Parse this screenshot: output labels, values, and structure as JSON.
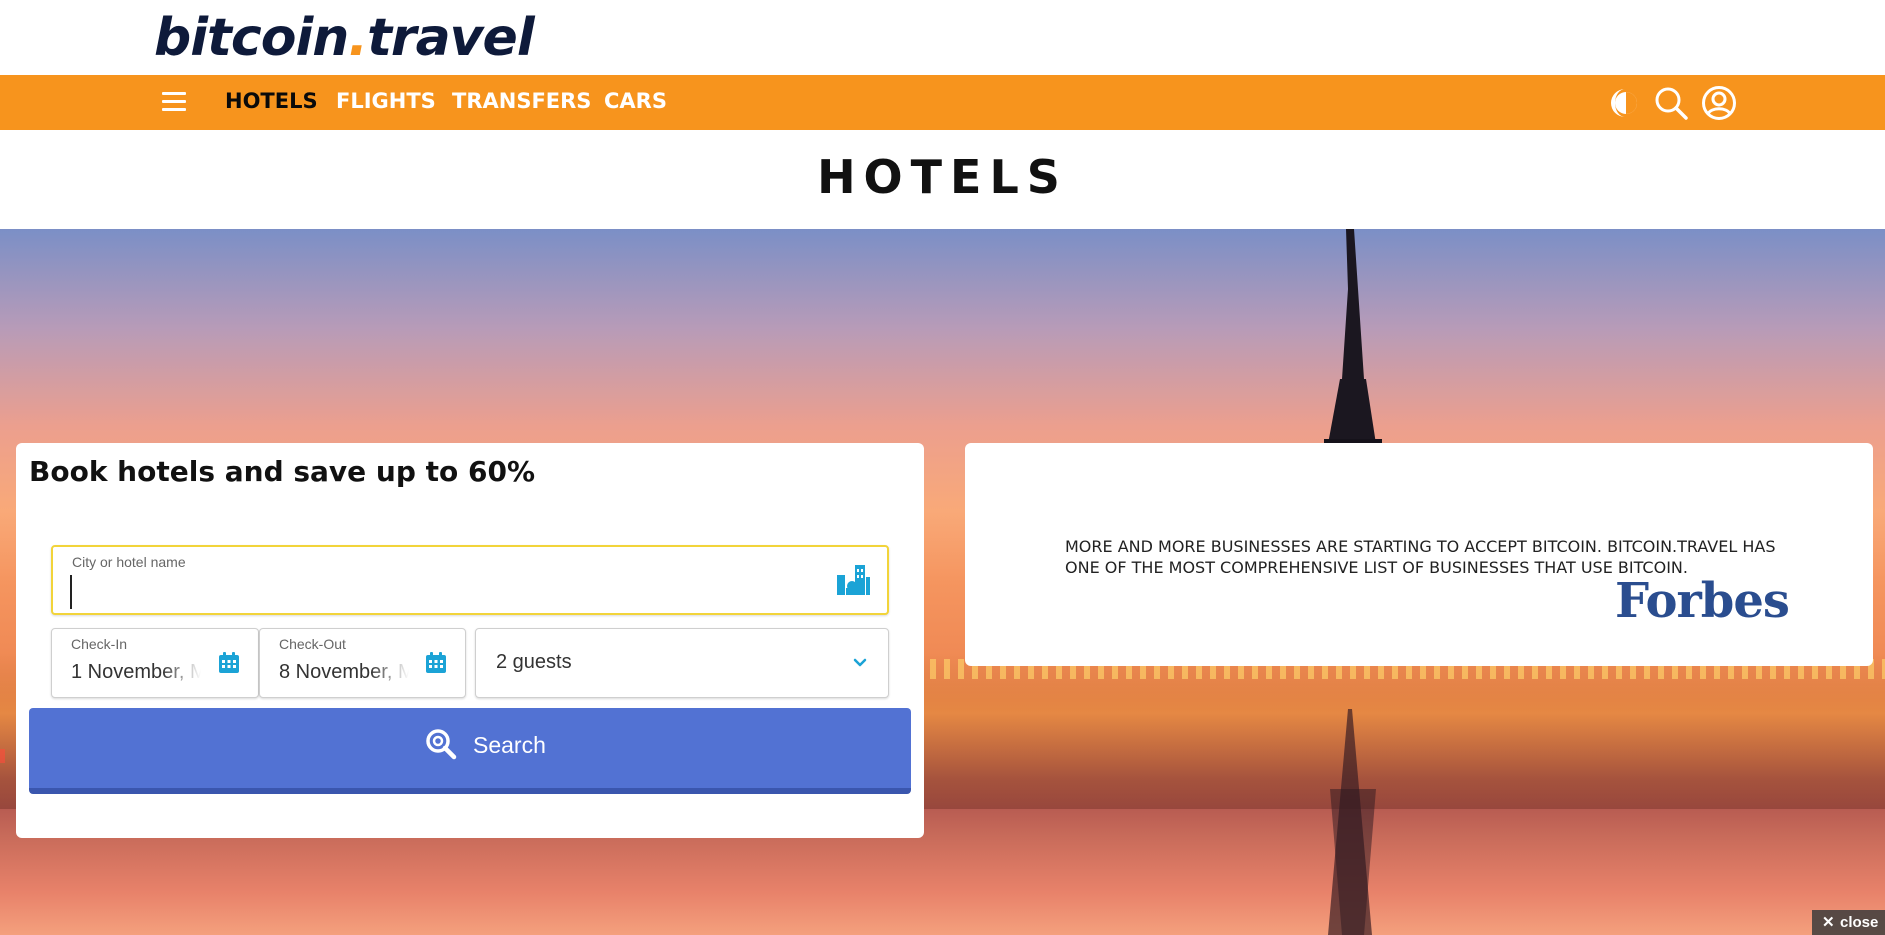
{
  "brand": {
    "name_part1": "bitcoin",
    "name_dot": ".",
    "name_part2": "travel",
    "accent_color": "#f7941d",
    "dark_color": "#0e1a3a"
  },
  "nav": {
    "items": [
      {
        "label": "HOTELS",
        "active": true
      },
      {
        "label": "FLIGHTS",
        "active": false
      },
      {
        "label": "TRANSFERS",
        "active": false
      },
      {
        "label": "CARS",
        "active": false
      }
    ],
    "icons": [
      "menu-icon",
      "dark-mode-icon",
      "search-icon",
      "account-icon"
    ]
  },
  "page": {
    "title": "HOTELS"
  },
  "booking": {
    "title": "Book hotels and save up to 60%",
    "city_label": "City or hotel name",
    "city_value": "",
    "checkin_label": "Check-In",
    "checkin_value": "1 November, M",
    "checkout_label": "Check-Out",
    "checkout_value": "8 November, M",
    "guests_value": "2 guests",
    "search_label": "Search",
    "button_color": "#5272d3"
  },
  "forbes": {
    "quote": "MORE AND MORE BUSINESSES ARE STARTING TO ACCEPT BITCOIN. BITCOIN.TRAVEL HAS ONE OF THE MOST COMPREHENSIVE LIST OF BUSINESSES THAT USE BITCOIN.",
    "logo_text": "Forbes",
    "logo_color": "#2a4d8f"
  },
  "overlay": {
    "close_label": "close"
  }
}
